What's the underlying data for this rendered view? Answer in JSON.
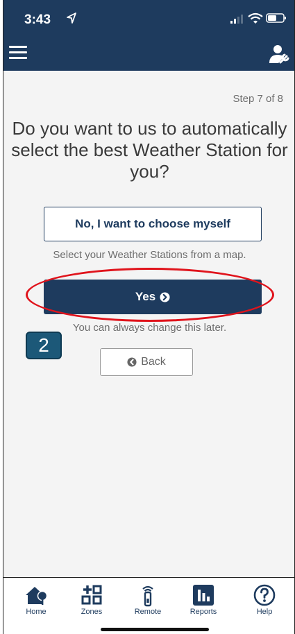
{
  "status_bar": {
    "time": "3:43"
  },
  "step_label": "Step 7 of 8",
  "question": "Do you want to us to automatically select the best Weather Station for you?",
  "choose_button": "No, I want to choose myself",
  "choose_hint": "Select your Weather Stations from a map.",
  "yes_button": "Yes",
  "yes_hint": "You can always change this later.",
  "annotation_badge": "2",
  "back_button": "Back",
  "tabs": [
    {
      "label": "Home",
      "icon": "home-icon"
    },
    {
      "label": "Zones",
      "icon": "zones-icon"
    },
    {
      "label": "Remote",
      "icon": "remote-icon"
    },
    {
      "label": "Reports",
      "icon": "reports-icon"
    },
    {
      "label": "Help",
      "icon": "help-icon"
    }
  ],
  "colors": {
    "primary": "#1e3b5e",
    "highlight": "#e0141c",
    "badge": "#1c5878"
  }
}
